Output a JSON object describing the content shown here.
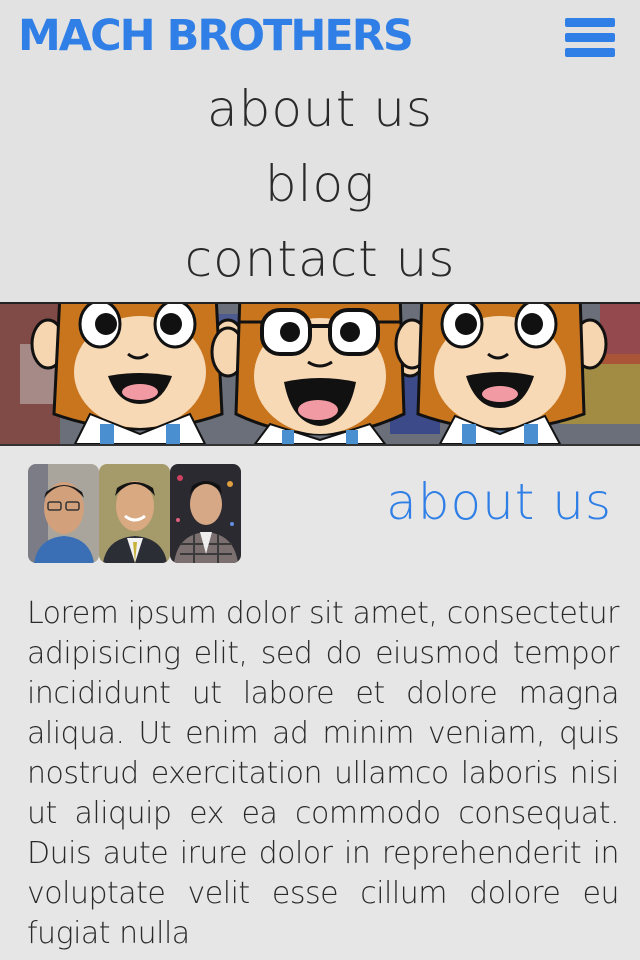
{
  "header": {
    "logo_text": "MACH BROTHERS",
    "brand_color": "#2f7fe6",
    "menu_icon": "hamburger-menu-icon"
  },
  "nav": {
    "items": [
      {
        "label": "about us"
      },
      {
        "label": "blog"
      },
      {
        "label": "contact us"
      }
    ]
  },
  "banner": {
    "image": "three cartoon monkey mascots"
  },
  "about": {
    "title": "about us",
    "photos": [
      "team-member-1",
      "team-member-2",
      "team-member-3"
    ],
    "body": "Lorem ipsum dolor sit amet, consectetur adipisicing elit, sed do eiusmod tempor incididunt ut labore et dolore magna aliqua. Ut enim ad minim veniam, quis nostrud exercitation ullamco laboris nisi ut aliquip ex ea commodo consequat. Duis aute irure dolor in reprehenderit in voluptate velit esse cillum dolore eu fugiat nulla"
  }
}
